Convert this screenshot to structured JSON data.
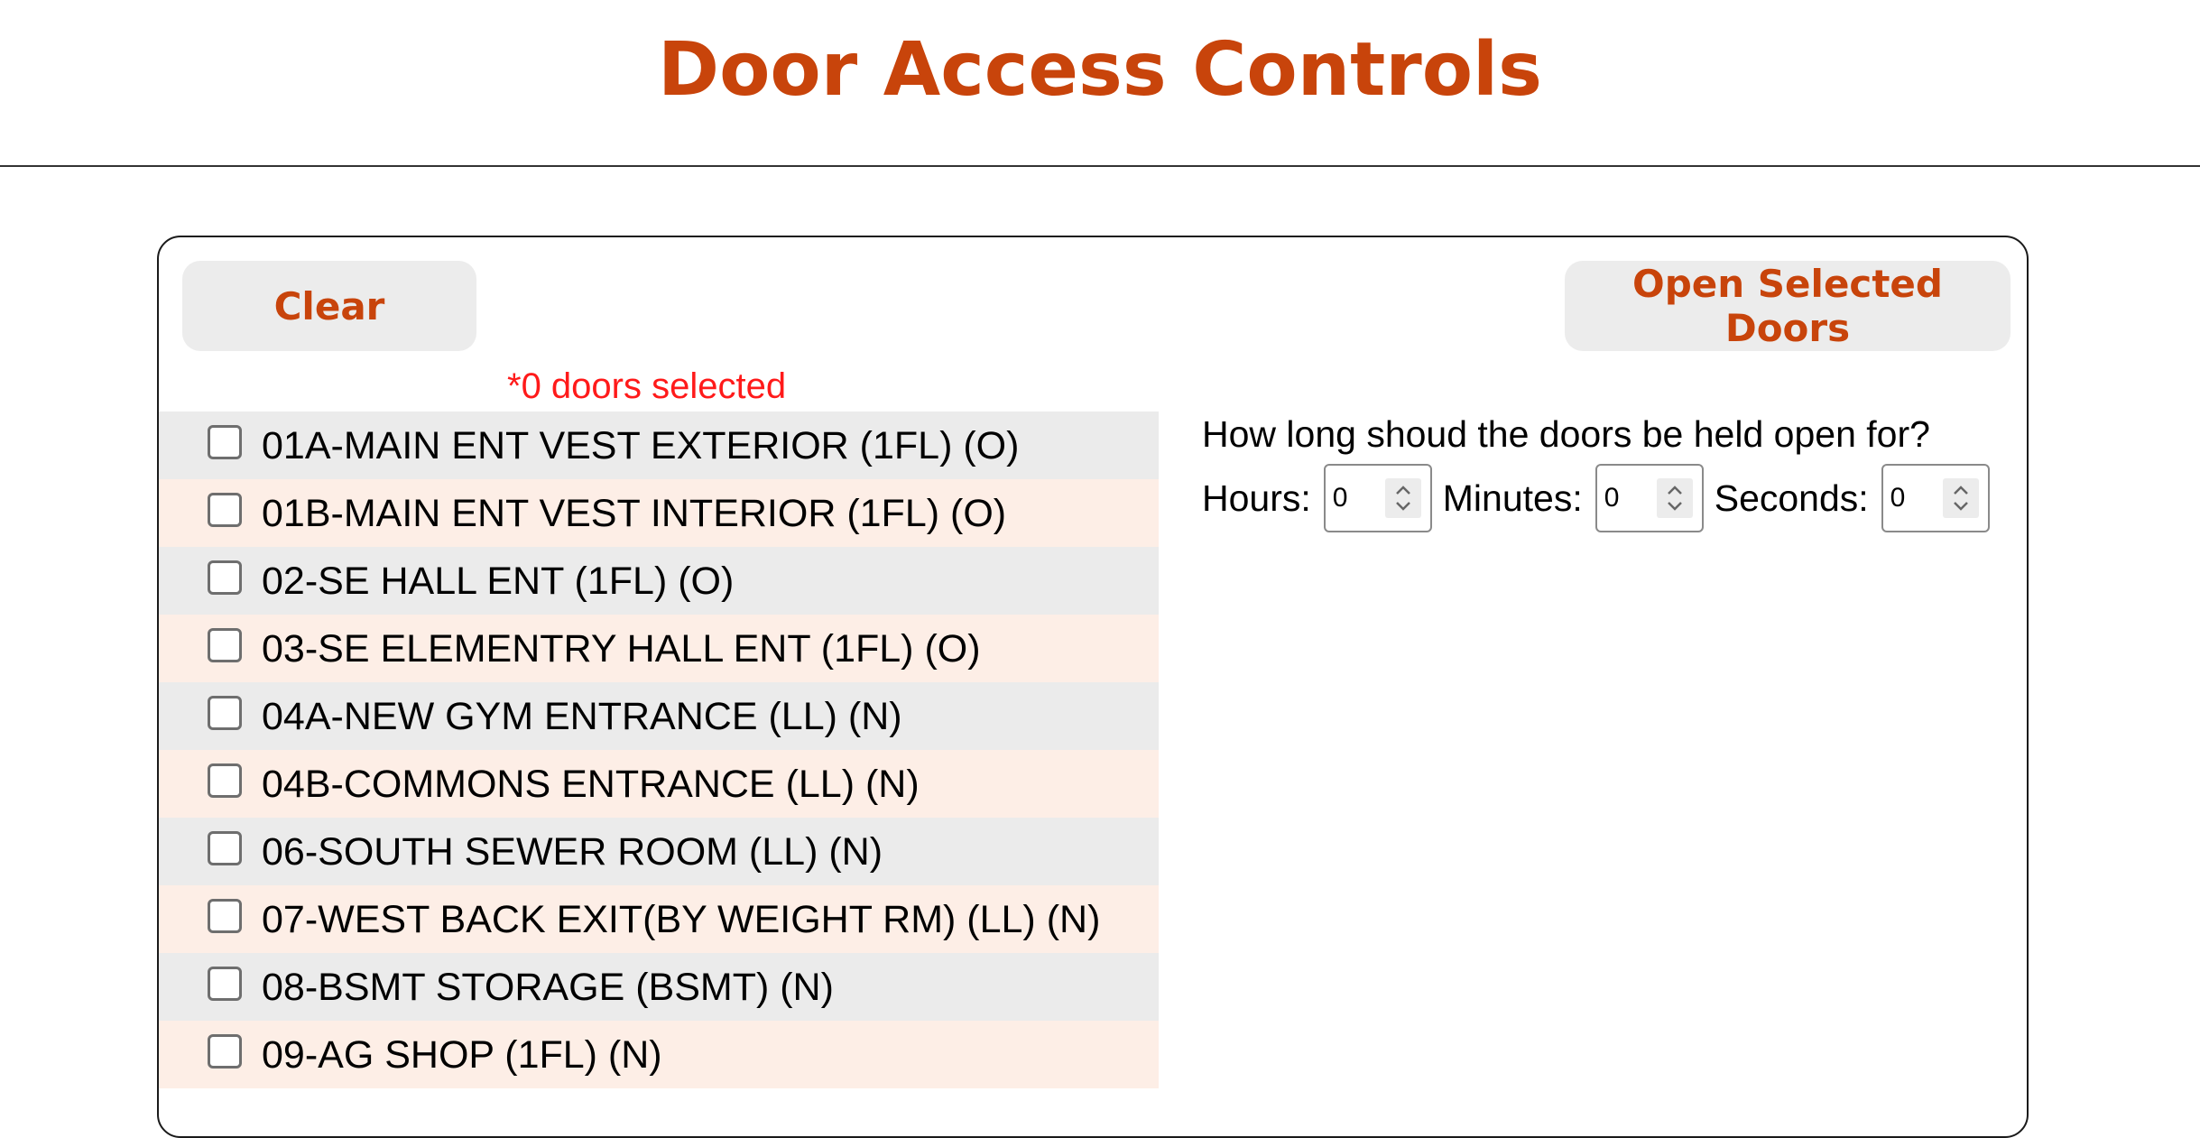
{
  "header": {
    "title": "Door Access Controls"
  },
  "controls": {
    "clear_label": "Clear",
    "open_label": "Open Selected Doors",
    "selected_count_text": "*0 doors selected"
  },
  "doors": [
    {
      "label": "01A-MAIN ENT VEST EXTERIOR (1FL) (O)",
      "checked": false
    },
    {
      "label": "01B-MAIN ENT VEST INTERIOR (1FL) (O)",
      "checked": false
    },
    {
      "label": "02-SE HALL ENT (1FL) (O)",
      "checked": false
    },
    {
      "label": "03-SE ELEMENTRY HALL ENT (1FL) (O)",
      "checked": false
    },
    {
      "label": "04A-NEW GYM ENTRANCE (LL) (N)",
      "checked": false
    },
    {
      "label": "04B-COMMONS ENTRANCE (LL) (N)",
      "checked": false
    },
    {
      "label": "06-SOUTH SEWER ROOM (LL) (N)",
      "checked": false
    },
    {
      "label": "07-WEST BACK EXIT(BY WEIGHT RM) (LL) (N)",
      "checked": false
    },
    {
      "label": "08-BSMT STORAGE (BSMT) (N)",
      "checked": false
    },
    {
      "label": "09-AG SHOP (1FL) (N)",
      "checked": false
    }
  ],
  "hold_open": {
    "question": "How long shoud the doors be held open for?",
    "hours_label": "Hours:",
    "hours_value": "0",
    "minutes_label": "Minutes:",
    "minutes_value": "0",
    "seconds_label": "Seconds:",
    "seconds_value": "0"
  },
  "colors": {
    "accent": "#c8440b",
    "count_text": "#ff1a1a",
    "row_odd": "#ebebeb",
    "row_even": "#fdeee6",
    "button_bg": "#ececec"
  },
  "icons": {
    "spinner": "spinner-arrows-icon"
  }
}
